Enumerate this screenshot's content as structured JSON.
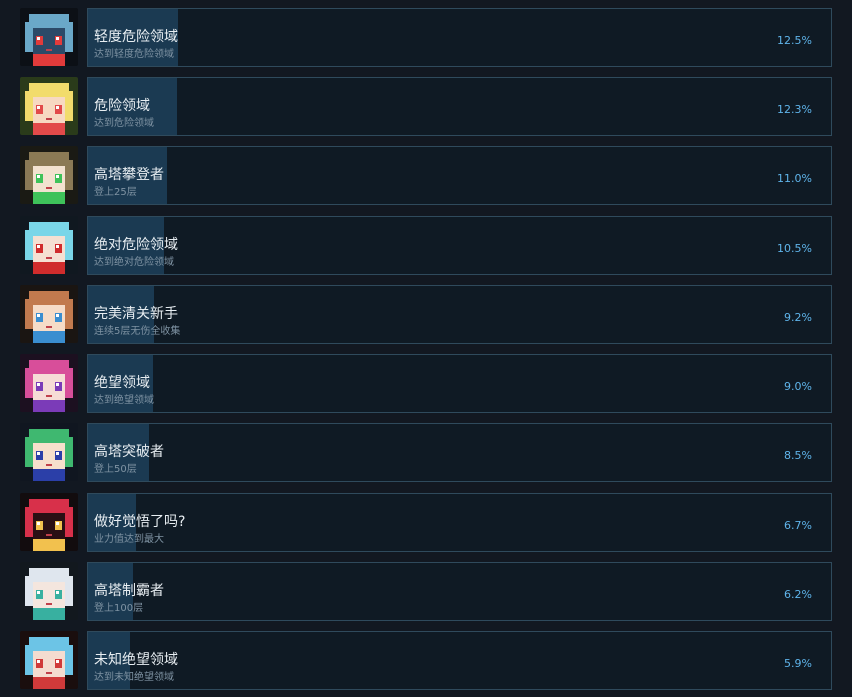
{
  "achievements": [
    {
      "title": "轻度危险领域",
      "desc": "达到轻度危险领域",
      "percent": "12.5%",
      "rate": 12.5,
      "icon": "knight-skull-avatar-icon",
      "colors": {
        "skin": "#2c4a68",
        "hair": "#6aa8c8",
        "accent": "#e23b3b",
        "bg": "#0c1016"
      }
    },
    {
      "title": "危险领域",
      "desc": "达到危险领域",
      "percent": "12.3%",
      "rate": 12.3,
      "icon": "blonde-girl-avatar-icon",
      "colors": {
        "skin": "#f7d9c2",
        "hair": "#f2dc6c",
        "accent": "#e24a4a",
        "bg": "#2a3b1a"
      }
    },
    {
      "title": "高塔攀登者",
      "desc": "登上25层",
      "percent": "11.0%",
      "rate": 11.0,
      "icon": "green-eyed-girl-avatar-icon",
      "colors": {
        "skin": "#f2e2d0",
        "hair": "#8b7a55",
        "accent": "#3ec25a",
        "bg": "#1a1a14"
      }
    },
    {
      "title": "绝对危险领域",
      "desc": "达到绝对危险领域",
      "percent": "10.5%",
      "rate": 10.5,
      "icon": "cyan-hair-girl-avatar-icon",
      "colors": {
        "skin": "#f5e0d2",
        "hair": "#7ad6e8",
        "accent": "#d02c2c",
        "bg": "#101820"
      }
    },
    {
      "title": "完美清关新手",
      "desc": "连续5层无伤全收集",
      "percent": "9.2%",
      "rate": 9.2,
      "icon": "brown-hair-girl-avatar-icon",
      "colors": {
        "skin": "#f6dcc8",
        "hair": "#c27a4e",
        "accent": "#3a8ed0",
        "bg": "#1a1512"
      }
    },
    {
      "title": "绝望领域",
      "desc": "达到绝望领域",
      "percent": "9.0%",
      "rate": 9.0,
      "icon": "pink-hair-girl-avatar-icon",
      "colors": {
        "skin": "#f6dcd6",
        "hair": "#d84e9a",
        "accent": "#7b3bb8",
        "bg": "#1c1020"
      }
    },
    {
      "title": "高塔突破者",
      "desc": "登上50层",
      "percent": "8.5%",
      "rate": 8.5,
      "icon": "witch-girl-avatar-icon",
      "colors": {
        "skin": "#f6e0cc",
        "hair": "#3fb870",
        "accent": "#2b3fa8",
        "bg": "#101620"
      }
    },
    {
      "title": "做好觉悟了吗?",
      "desc": "业力值达到最大",
      "percent": "6.7%",
      "rate": 6.7,
      "icon": "red-demon-hood-avatar-icon",
      "colors": {
        "skin": "#2a0f14",
        "hair": "#d8304a",
        "accent": "#f2c14e",
        "bg": "#120c0e"
      }
    },
    {
      "title": "高塔制霸者",
      "desc": "登上100层",
      "percent": "6.2%",
      "rate": 6.2,
      "icon": "white-hair-girl-avatar-icon",
      "colors": {
        "skin": "#f4e6de",
        "hair": "#dfe6ee",
        "accent": "#38b0a0",
        "bg": "#12181e"
      }
    },
    {
      "title": "未知绝望领域",
      "desc": "达到未知绝望领域",
      "percent": "5.9%",
      "rate": 5.9,
      "icon": "horned-cyan-girl-avatar-icon",
      "colors": {
        "skin": "#f4dcd0",
        "hair": "#6cc4e6",
        "accent": "#d03a3a",
        "bg": "#1a0e0e"
      }
    }
  ]
}
